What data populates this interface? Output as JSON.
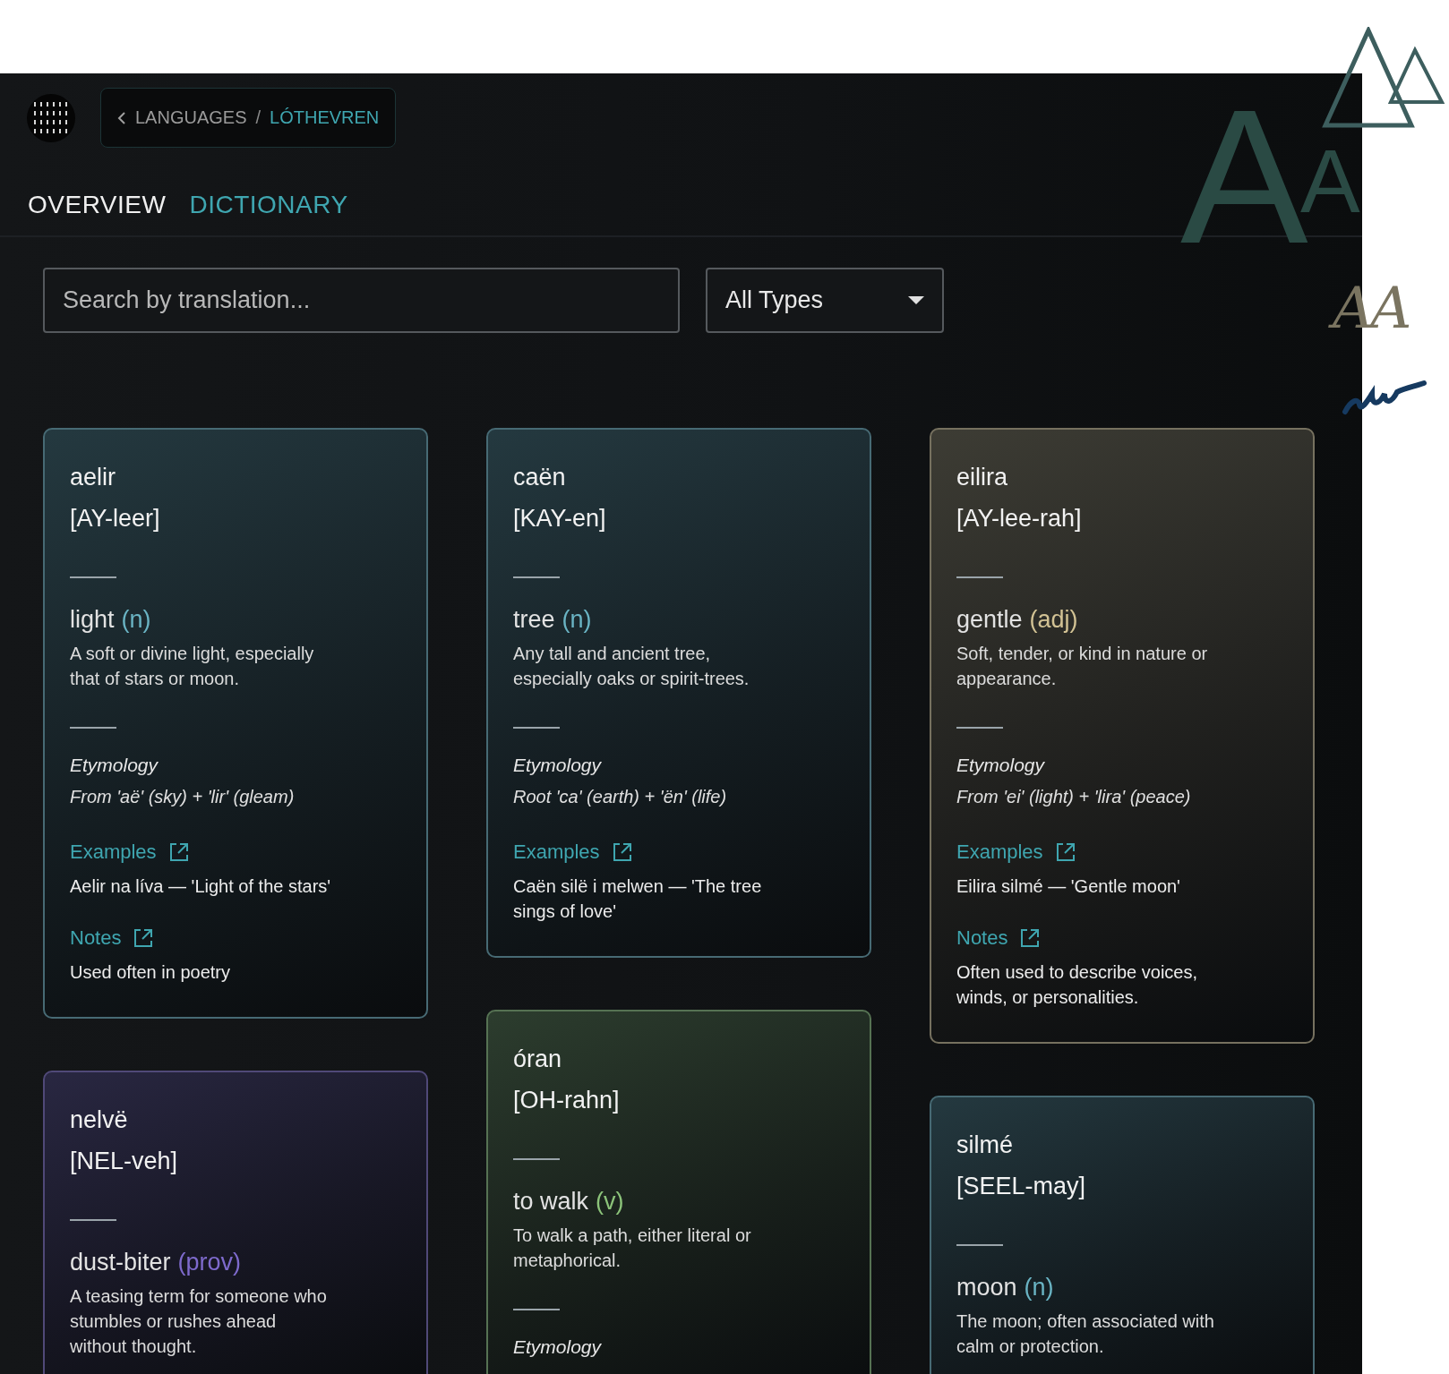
{
  "header": {
    "breadcrumb": {
      "parent": "LANGUAGES",
      "separator": "/",
      "current": "LÓTHEVREN"
    }
  },
  "tabs": [
    {
      "label": "OVERVIEW",
      "selected": false
    },
    {
      "label": "DICTIONARY",
      "selected": true
    }
  ],
  "filters": {
    "search": {
      "placeholder": "Search by translation..."
    },
    "type_select": {
      "value": "All Types"
    }
  },
  "columns": [
    {
      "cards": [
        {
          "word": "aelir",
          "pronunciation": "[AY-leer]",
          "meaning": "light",
          "pos": "(n)",
          "definition": "A soft or divine light, especially that of stars or moon.",
          "etymology_label": "Etymology",
          "etymology": "From 'aë' (sky) + 'lir' (gleam)",
          "examples_label": "Examples",
          "example": "Aelir na líva — 'Light of the stars'",
          "notes_label": "Notes",
          "notes": "Used often in poetry",
          "color": "#6ab4c4"
        },
        {
          "word": "nelvë",
          "pronunciation": "[NEL-veh]",
          "meaning": "dust-biter",
          "pos": "(prov)",
          "definition": "A teasing term for someone who stumbles or rushes ahead without thought.",
          "color": "#7e6acc"
        }
      ]
    },
    {
      "cards": [
        {
          "word": "caën",
          "pronunciation": "[KAY-en]",
          "meaning": "tree",
          "pos": "(n)",
          "definition": "Any tall and ancient tree, especially oaks or spirit-trees.",
          "etymology_label": "Etymology",
          "etymology": "Root 'ca' (earth) + 'ën' (life)",
          "examples_label": "Examples",
          "example": "Caën silë i melwen — 'The tree sings of love'",
          "color": "#6ab4c4"
        },
        {
          "word": "óran",
          "pronunciation": "[OH-rahn]",
          "meaning": "to walk",
          "pos": "(v)",
          "definition": "To walk a path, either literal or metaphorical.",
          "etymology_label": "Etymology",
          "color": "#8cc47a"
        }
      ]
    },
    {
      "cards": [
        {
          "word": "eilira",
          "pronunciation": "[AY-lee-rah]",
          "meaning": "gentle",
          "pos": "(adj)",
          "definition": "Soft, tender, or kind in nature or appearance.",
          "etymology_label": "Etymology",
          "etymology": "From 'ei' (light) + 'lira' (peace)",
          "examples_label": "Examples",
          "example": "Eilira silmé — 'Gentle moon'",
          "notes_label": "Notes",
          "notes": "Often used to describe voices, winds, or personalities.",
          "color": "#d2c294"
        },
        {
          "word": "silmé",
          "pronunciation": "[SEEL-may]",
          "meaning": "moon",
          "pos": "(n)",
          "definition": "The moon; often associated with calm or protection.",
          "color": "#6ab4c4"
        }
      ]
    }
  ],
  "decoration": {
    "letter_large": "A",
    "letter_small": "A",
    "script_letters": "AA"
  }
}
